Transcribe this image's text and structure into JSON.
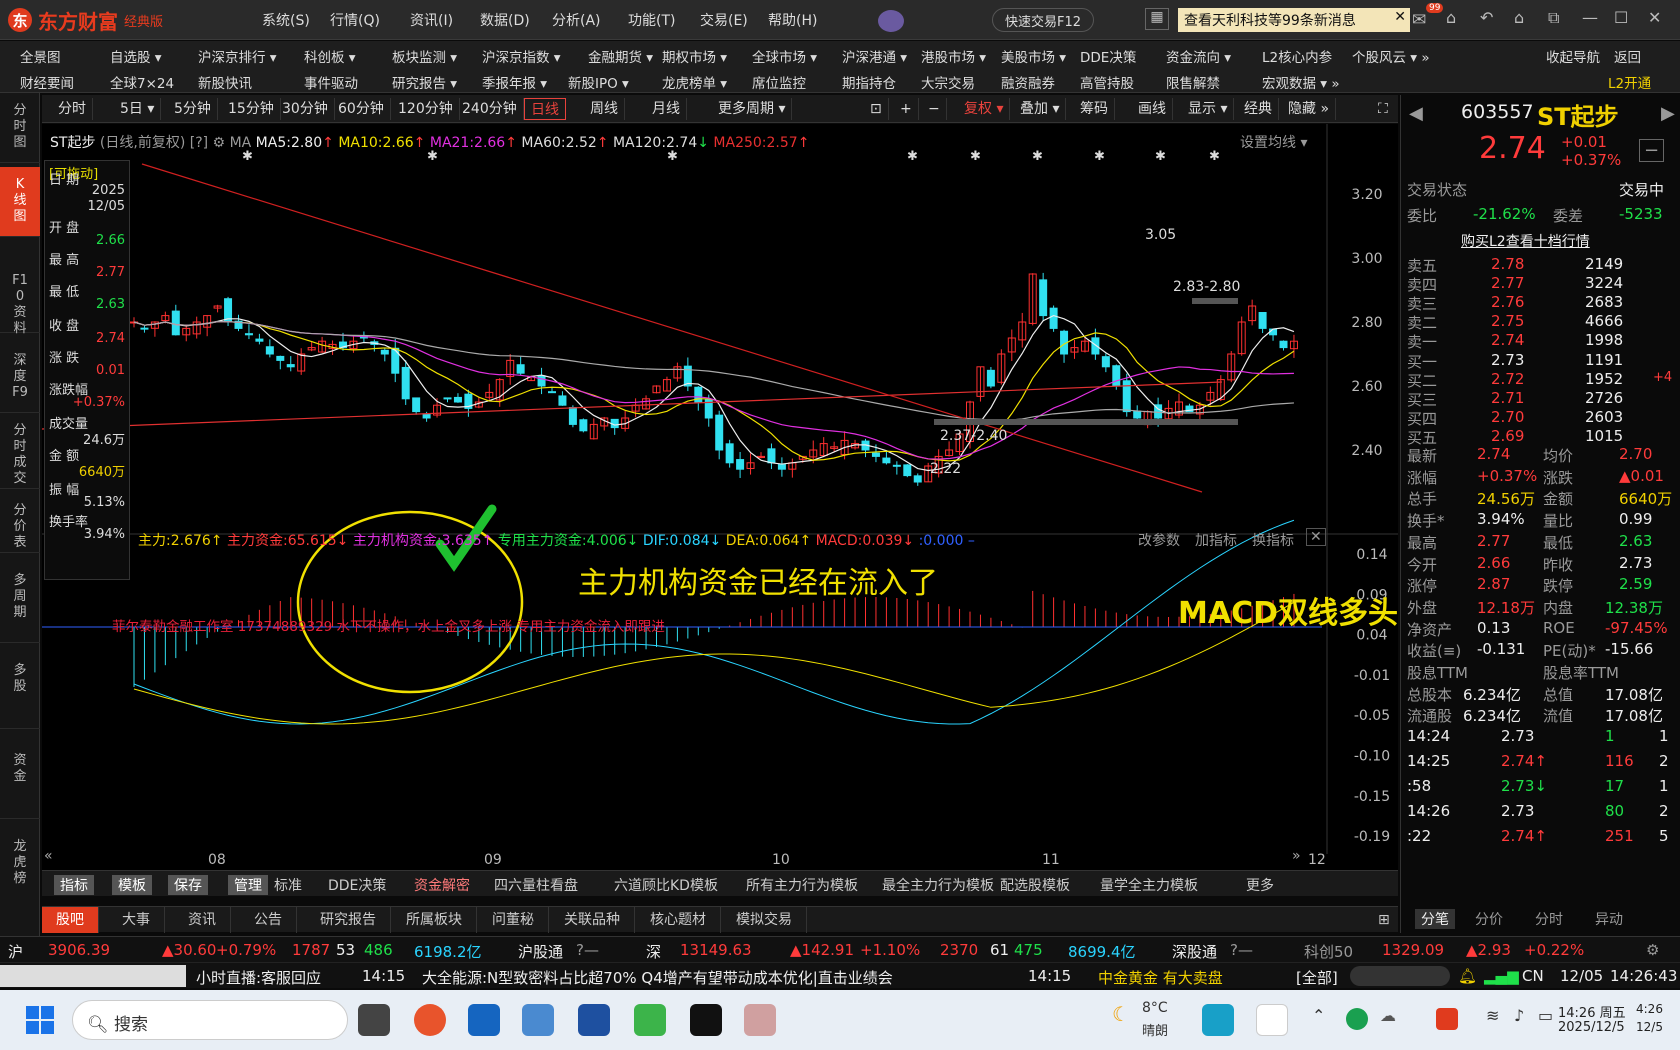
{
  "app": {
    "brand": "东方财富",
    "edition": "经典版",
    "menu": [
      "系统(S)",
      "行情(Q)",
      "资讯(I)",
      "数据(D)",
      "分析(A)",
      "功能(T)",
      "交易(E)",
      "帮助(H)"
    ],
    "quick_trade": "快速交易F12",
    "notice": "查看天利科技等99条新消息",
    "badge": "99"
  },
  "nav1": [
    "全景图",
    "自选股 ▾",
    "沪深京排行 ▾",
    "科创板 ▾",
    "板块监测 ▾",
    "沪深京指数 ▾",
    "金融期货 ▾",
    "期权市场 ▾",
    "全球市场 ▾",
    "沪深港通 ▾",
    "港股市场 ▾",
    "美股市场 ▾",
    "DDE决策",
    "资金流向 ▾",
    "L2核心内参",
    "个股风云 ▾ »",
    "收起导航",
    "返回"
  ],
  "nav2": [
    "财经要闻",
    "全球7×24",
    "新股快讯",
    "事件驱动",
    "研究报告 ▾",
    "季报年报 ▾",
    "新股IPO ▾",
    "龙虎榜单 ▾",
    "席位监控",
    "期指持仓",
    "大宗交易",
    "融资融券",
    "高管持股",
    "限售解禁",
    "宏观数据 ▾ »",
    "L2开通"
  ],
  "leftbar": [
    "分时图",
    "K线图",
    "F10资料",
    "深度F9",
    "分时成交",
    "分价表",
    "多周期",
    "多股",
    "资金",
    "龙虎榜"
  ],
  "periods": [
    "分时",
    "5日 ▾",
    "5分钟",
    "15分钟",
    "30分钟",
    "60分钟",
    "120分钟",
    "240分钟",
    "日线",
    "周线",
    "月线",
    "更多周期 ▾"
  ],
  "tools": [
    "复权 ▾",
    "叠加 ▾",
    "筹码",
    "画线",
    "显示 ▾",
    "经典",
    "隐藏 »"
  ],
  "ma": {
    "name": "ST起步",
    "mode": "(日线,前复权)",
    "ma5": "MA5:2.80",
    "ma10": "MA10:2.66",
    "ma21": "MA21:2.66",
    "ma60": "MA60:2.52",
    "ma120": "MA120:2.74",
    "ma250": "MA250:2.57",
    "setting": "设置均线 ▾"
  },
  "infobox": {
    "drag": "[可拖动]",
    "date_l": "日 期",
    "date_v1": "2025",
    "date_v2": "12/05",
    "open_l": "开 盘",
    "open_v": "2.66",
    "high_l": "最 高",
    "high_v": "2.77",
    "low_l": "最 低",
    "low_v": "2.63",
    "close_l": "收 盘",
    "close_v": "2.74",
    "chg_l": "涨 跌",
    "chg_v": "0.01",
    "pct_l": "涨跌幅",
    "pct_v": "+0.37%",
    "vol_l": "成交量",
    "vol_v": "24.6万",
    "amt_l": "金 额",
    "amt_v": "6640万",
    "amp_l": "振 幅",
    "amp_v": "5.13%",
    "turn_l": "换手率",
    "turn_v": "3.94%"
  },
  "indicators": {
    "zl": "主力:2.676↑",
    "zlzj": "主力资金:65.615↓",
    "zljg": "主力机构资金:3.635↑",
    "zyzl": "专用主力资金:4.006↓",
    "dif": "DIF:0.084↓",
    "dea": "DEA:0.064↑",
    "macd": "MACD:0.039↓",
    "zero": ":0.000 –",
    "params": "改参数",
    "add": "加指标",
    "swap": "换指标"
  },
  "annot": {
    "main": "主力机构资金已经在流入了",
    "macd": "MACD双线多头",
    "studio": "菲尔泰勒金融工作室 17374889329 水下不操作，水上金叉多上涨 专用主力资金流入即跟进",
    "p305": "3.05",
    "p283": "2.83-2.80",
    "p237": "2.37-2.40",
    "p222": "2.22"
  },
  "priceaxis": [
    "3.20",
    "3.00",
    "2.80",
    "2.60",
    "2.40"
  ],
  "indaxis": [
    "0.14",
    "0.09",
    "0.04",
    "-0.01",
    "-0.05",
    "-0.10",
    "-0.15",
    "-0.19"
  ],
  "months": [
    "08",
    "09",
    "10",
    "11",
    "12"
  ],
  "tabs1": [
    "指标",
    "模板",
    "保存",
    "管理",
    "标准",
    "DDE决策",
    "资金解密",
    "四六量柱看盘",
    "六道顾比KD模板",
    "所有主力行为模板",
    "最全主力行为模板",
    "配选股模板",
    "量学全主力模板",
    "更多"
  ],
  "tabs2": [
    "股吧",
    "大事",
    "资讯",
    "公告",
    "研究报告",
    "所属板块",
    "问董秘",
    "关联品种",
    "核心题材",
    "模拟交易"
  ],
  "quote": {
    "code": "603557",
    "name": "ST起步",
    "price": "2.74",
    "chg": "+0.01",
    "pct": "+0.37%",
    "state_l": "交易状态",
    "state_v": "交易中",
    "wb_l": "委比",
    "wb_v": "-21.62%",
    "wc_l": "委差",
    "wc_v": "-5233",
    "l2": "购买L2查看十档行情",
    "asks": [
      [
        "卖五",
        "2.78",
        "2149"
      ],
      [
        "卖四",
        "2.77",
        "3224"
      ],
      [
        "卖三",
        "2.76",
        "2683"
      ],
      [
        "卖二",
        "2.75",
        "4666"
      ],
      [
        "卖一",
        "2.74",
        "1998"
      ]
    ],
    "bids": [
      [
        "买一",
        "2.73",
        "1191",
        ""
      ],
      [
        "买二",
        "2.72",
        "1952",
        "+4"
      ],
      [
        "买三",
        "2.71",
        "2726",
        ""
      ],
      [
        "买四",
        "2.70",
        "2603",
        ""
      ],
      [
        "买五",
        "2.69",
        "1015",
        ""
      ]
    ],
    "stats": [
      [
        "最新",
        "2.74",
        "均价",
        "2.70"
      ],
      [
        "涨幅",
        "+0.37%",
        "涨跌",
        "▲0.01"
      ],
      [
        "总手",
        "24.56万",
        "金额",
        "6640万"
      ],
      [
        "换手*",
        "3.94%",
        "量比",
        "0.99"
      ],
      [
        "最高",
        "2.77",
        "最低",
        "2.63"
      ],
      [
        "今开",
        "2.66",
        "昨收",
        "2.73"
      ],
      [
        "涨停",
        "2.87",
        "跌停",
        "2.59"
      ],
      [
        "外盘",
        "12.18万",
        "内盘",
        "12.38万"
      ],
      [
        "净资产",
        "0.13",
        "ROE",
        "-97.45%"
      ],
      [
        "收益(≡)",
        "-0.131",
        "PE(动)*",
        "-15.66"
      ],
      [
        "股息TTM",
        "",
        "股息率TTM",
        ""
      ],
      [
        "总股本",
        "6.234亿",
        "总值",
        "17.08亿"
      ],
      [
        "流通股",
        "6.234亿",
        "流值",
        "17.08亿"
      ]
    ],
    "ticks": [
      [
        "14:24",
        "2.73",
        "1",
        "1"
      ],
      [
        "14:25",
        "2.74↑",
        "116",
        "2"
      ],
      [
        ":58",
        "2.73↓",
        "17",
        "1"
      ],
      [
        "14:26",
        "2.73",
        "80",
        "2"
      ],
      [
        ":22",
        "2.74↑",
        "251",
        "5"
      ]
    ],
    "tabs": [
      "分笔",
      "分价",
      "分时",
      "异动"
    ]
  },
  "status": {
    "sh": "沪",
    "sh_v": "3906.39",
    "sh_c": "▲30.60",
    "sh_p": "+0.79%",
    "sh_u": "1787",
    "sh_e": "53",
    "sh_d": "486",
    "sh_amt": "6198.2亿",
    "hgt": "沪股通",
    "sz": "深",
    "sz_v": "13149.63",
    "sz_c": "▲142.91",
    "sz_p": "+1.10%",
    "sz_u": "2370",
    "sz_e": "61",
    "sz_d": "475",
    "sz_amt": "8699.4亿",
    "sgt": "深股通",
    "kc": "科创50",
    "kc_v": "1329.09",
    "kc_c": "▲2.93",
    "kc_p": "+0.22%"
  },
  "ticker": {
    "live": "小时直播:客服回应",
    "t1": "14:15",
    "n1": "大全能源:N型致密料占比超70% Q4增产有望带动成本优化|直击业绩会",
    "t2": "14:15",
    "n2": "中金黄金 有大卖盘",
    "all": "[全部]",
    "cn": "CN",
    "date": "12/05",
    "time": "14:26:43"
  },
  "taskbar": {
    "search": "搜索",
    "weather": "8°C",
    "weather2": "晴朗",
    "clock1": "14:26 周五",
    "clock2": "2025/12/5",
    "clock3": "4:26",
    "clock4": "12/5"
  }
}
